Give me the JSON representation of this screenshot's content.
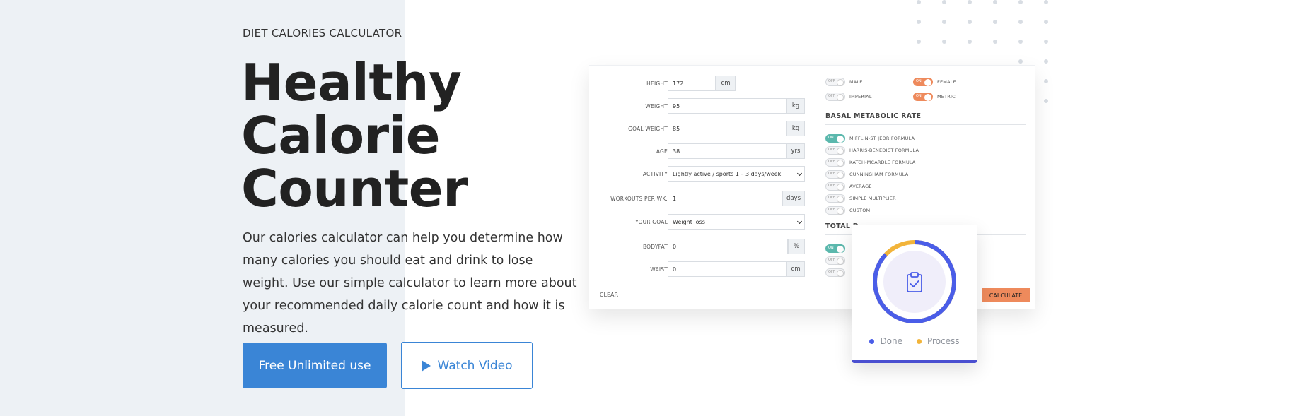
{
  "hero": {
    "eyebrow": "DIET CALORIES CALCULATOR",
    "headline_lines": [
      "Healthy",
      "Calorie",
      "Counter"
    ],
    "description": "Our calories calculator can help you determine how many calories you should eat and drink to lose weight. Use our simple calculator to learn more about your recommended daily calorie count and how it is measured.",
    "primary_button": "Free Unlimited use",
    "secondary_button": "Watch Video"
  },
  "calculator": {
    "fields": [
      {
        "label": "HEIGHT",
        "value": "172",
        "unit": "cm"
      },
      {
        "label": "WEIGHT",
        "value": "95",
        "unit": "kg"
      },
      {
        "label": "GOAL WEIGHT",
        "value": "85",
        "unit": "kg"
      },
      {
        "label": "AGE",
        "value": "38",
        "unit": "yrs"
      },
      {
        "label": "ACTIVITY",
        "value": "Lightly active / sports 1 – 3 days/week",
        "unit": ""
      },
      {
        "label": "WORKOUTS PER WK.",
        "value": "1",
        "unit": "days"
      },
      {
        "label": "YOUR GOAL",
        "value": "Weight loss",
        "unit": ""
      },
      {
        "label": "BODYFAT",
        "value": "0",
        "unit": "%"
      },
      {
        "label": "WAIST",
        "value": "0",
        "unit": "cm"
      }
    ],
    "gender": {
      "male_toggle": "OFF",
      "male_label": "MALE",
      "female_toggle": "ON",
      "female_label": "FEMALE"
    },
    "units": {
      "imperial_toggle": "OFF",
      "imperial_label": "IMPERIAL",
      "metric_toggle": "ON",
      "metric_label": "METRIC"
    },
    "bmr_title": "BASAL METABOLIC RATE",
    "bmr_options": [
      {
        "toggle": "ON",
        "label": "MIFFLIN-ST JEOR FORMULA"
      },
      {
        "toggle": "OFF",
        "label": "HARRIS-BENEDICT FORMULA"
      },
      {
        "toggle": "OFF",
        "label": "KATCH-MCARDLE FORMULA"
      },
      {
        "toggle": "OFF",
        "label": "CUNNINGHAM FORMULA"
      },
      {
        "toggle": "OFF",
        "label": "AVERAGE"
      },
      {
        "toggle": "OFF",
        "label": "SIMPLE MULTIPLIER"
      },
      {
        "toggle": "OFF",
        "label": "CUSTOM"
      }
    ],
    "tdee_title": "TOTAL D",
    "tdee_toggles": [
      "ON",
      "OFF",
      "OFF"
    ],
    "clear_label": "CLEAR",
    "calculate_label": "CALCULATE"
  },
  "progress_widget": {
    "done_label": "Done",
    "process_label": "Process",
    "done_fraction": 0.87,
    "colors": {
      "done": "#4a5de8",
      "process": "#f2b43a"
    },
    "center_icon": "clipboard-check-icon"
  },
  "colors": {
    "primary": "#3a85d6",
    "accent_orange": "#ee8a5c",
    "accent_teal": "#5bb8ad",
    "left_panel_bg": "#edf1f5"
  }
}
